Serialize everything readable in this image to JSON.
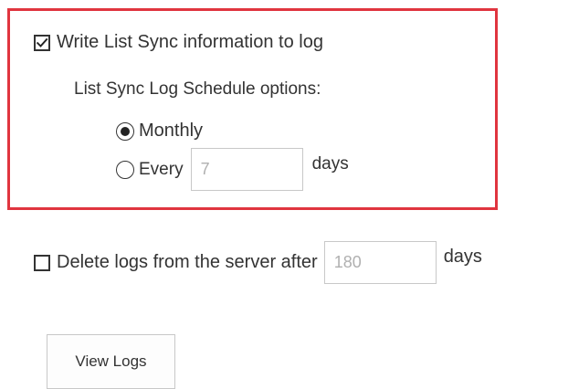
{
  "sync": {
    "write_log_label": "Write List Sync information to log",
    "write_log_checked": true,
    "schedule_title": "List Sync Log Schedule options:",
    "monthly_label": "Monthly",
    "monthly_selected": true,
    "every_label": "Every",
    "every_value": "7",
    "every_unit": "days"
  },
  "delete_logs": {
    "label": "Delete logs from the server after",
    "checked": false,
    "value": "180",
    "unit": "days"
  },
  "actions": {
    "view_logs_label": "View Logs"
  },
  "colors": {
    "highlight_border": "#e0353f",
    "text": "#333333",
    "input_border": "#c8c8c8",
    "input_text": "#b0b0b0"
  },
  "icons": {
    "checkbox_checked": "checkmark-icon"
  }
}
